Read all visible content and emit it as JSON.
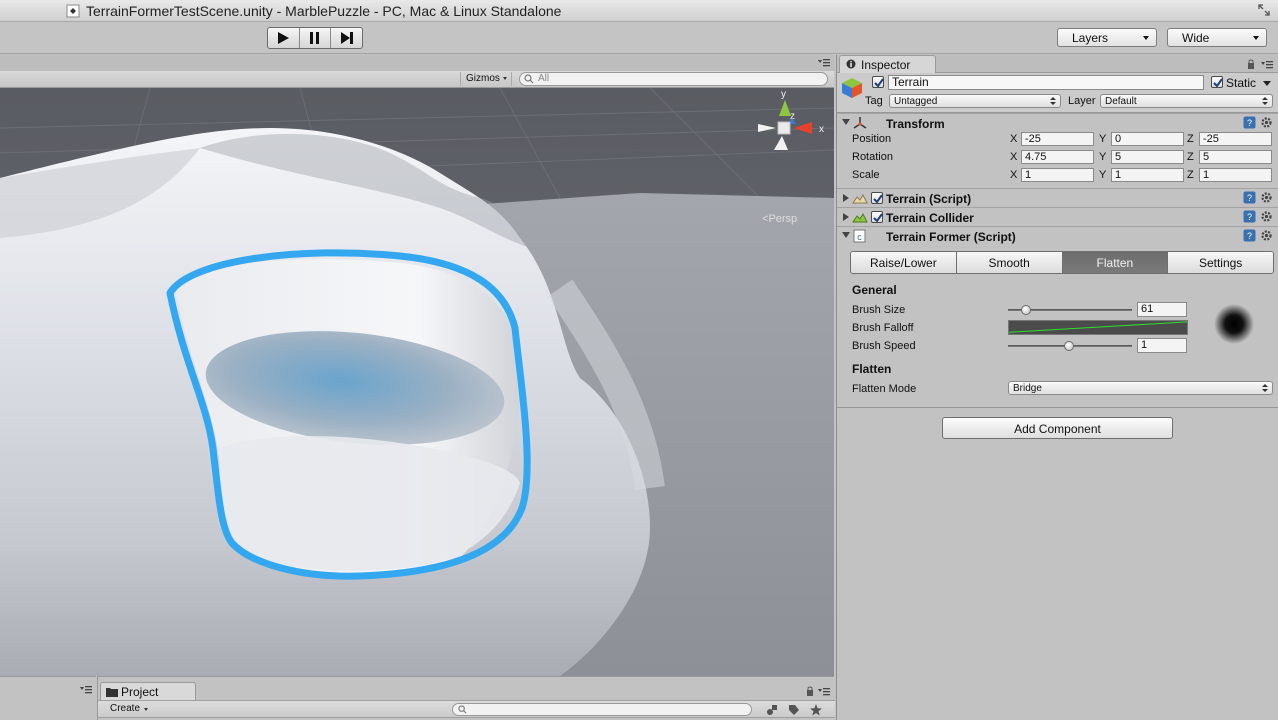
{
  "window": {
    "title": "TerrainFormerTestScene.unity - MarblePuzzle - PC, Mac & Linux Standalone"
  },
  "toolbar": {
    "play": "play-icon",
    "pause": "pause-icon",
    "step": "step-icon",
    "layers_label": "Layers",
    "layout_label": "Wide"
  },
  "scene": {
    "gizmos_label": "Gizmos",
    "search_placeholder": "All",
    "persp_label": "Persp",
    "gizmo_axes": {
      "y": "y",
      "z": "z",
      "x": "x"
    },
    "colors": {
      "highlight": "#33a8f0",
      "terrain": "#e6e9ef",
      "ground": "#9c9fa6"
    }
  },
  "project": {
    "tab_label": "Project",
    "create_label": "Create"
  },
  "inspector": {
    "tab_label": "Inspector",
    "gameobject": {
      "name": "Terrain",
      "active": true,
      "static": true,
      "static_label": "Static",
      "tag_label": "Tag",
      "tag_value": "Untagged",
      "layer_label": "Layer",
      "layer_value": "Default"
    },
    "transform": {
      "title": "Transform",
      "rows": [
        {
          "label": "Position",
          "x": "-25",
          "y": "0",
          "z": "-25"
        },
        {
          "label": "Rotation",
          "x": "4.75",
          "y": "5",
          "z": "5"
        },
        {
          "label": "Scale",
          "x": "1",
          "y": "1",
          "z": "1"
        }
      ],
      "axis_x": "X",
      "axis_y": "Y",
      "axis_z": "Z"
    },
    "terrain_script": {
      "title": "Terrain (Script)",
      "enabled": true
    },
    "terrain_collider": {
      "title": "Terrain Collider",
      "enabled": true
    },
    "terrain_former": {
      "title": "Terrain Former (Script)",
      "tabs": [
        "Raise/Lower",
        "Smooth",
        "Flatten",
        "Settings"
      ],
      "active_tab": "Flatten",
      "general_heading": "General",
      "brush_size_label": "Brush Size",
      "brush_size_value": "61",
      "brush_falloff_label": "Brush Falloff",
      "brush_speed_label": "Brush Speed",
      "brush_speed_value": "1",
      "flatten_heading": "Flatten",
      "flatten_mode_label": "Flatten Mode",
      "flatten_mode_value": "Bridge"
    },
    "add_component_label": "Add Component"
  }
}
